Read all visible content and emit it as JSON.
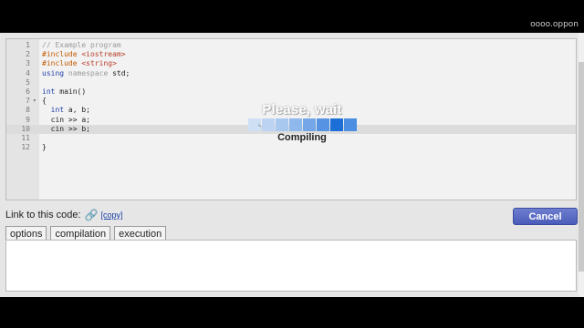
{
  "top_corner_text": "oooo.oppon",
  "editor": {
    "lines": [
      {
        "n": "1",
        "html": "<span class='cm'>// Example program</span>"
      },
      {
        "n": "2",
        "html": "<span class='pp'>#include</span> <span class='str'>&lt;iostream&gt;</span>"
      },
      {
        "n": "3",
        "html": "<span class='pp'>#include</span> <span class='str'>&lt;string&gt;</span>"
      },
      {
        "n": "4",
        "html": "<span class='kw'>using</span> <span class='cm'>namespace</span> std;"
      },
      {
        "n": "5",
        "html": ""
      },
      {
        "n": "6",
        "html": "<span class='kw'>int</span> main()"
      },
      {
        "n": "7",
        "html": "{",
        "fold": "▾"
      },
      {
        "n": "8",
        "html": "  <span class='kw'>int</span> a, b;"
      },
      {
        "n": "9",
        "html": "  cin &gt;&gt; a;"
      },
      {
        "n": "10",
        "html": "  cin &gt;&gt; b;",
        "active": true
      },
      {
        "n": "11",
        "html": ""
      },
      {
        "n": "12",
        "html": "}"
      }
    ]
  },
  "overlay": {
    "title": "Please, wait",
    "status": "Compiling",
    "progress_segments": [
      "#cfe0f5",
      "#bcd4f2",
      "#a8c8ef",
      "#8fb8ec",
      "#74a6e8",
      "#5793e3",
      "#1d6fd8",
      "#4b8ee2"
    ]
  },
  "link_row": {
    "label": "Link to this code:",
    "copy": "[copy]"
  },
  "cancel_label": "Cancel",
  "tabs": [
    "options",
    "compilation",
    "execution"
  ]
}
